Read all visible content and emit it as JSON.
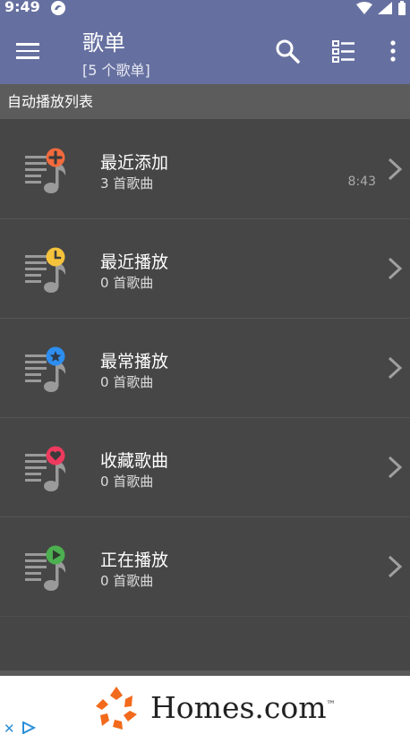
{
  "status_bar": {
    "time": "9:49"
  },
  "app_bar": {
    "title": "歌单",
    "subtitle": "[5 个歌单]",
    "actions": [
      "search-icon",
      "list-view-icon",
      "more-vert-icon"
    ]
  },
  "section": {
    "label": "自动播放列表"
  },
  "playlists": [
    {
      "title": "最近添加",
      "count": "3 首歌曲",
      "duration": "8:43",
      "badge_icon": "plus-icon",
      "badge_color": "#f26a3d"
    },
    {
      "title": "最近播放",
      "count": "0 首歌曲",
      "duration": "",
      "badge_icon": "clock-icon",
      "badge_color": "#f5c23c"
    },
    {
      "title": "最常播放",
      "count": "0 首歌曲",
      "duration": "",
      "badge_icon": "star-icon",
      "badge_color": "#2d8ef0"
    },
    {
      "title": "收藏歌曲",
      "count": "0 首歌曲",
      "duration": "",
      "badge_icon": "heart-icon",
      "badge_color": "#ee3a5e"
    },
    {
      "title": "正在播放",
      "count": "0 首歌曲",
      "duration": "",
      "badge_icon": "play-icon",
      "badge_color": "#4caf50"
    }
  ],
  "ad": {
    "brand": "Homes.com",
    "trademark": "™",
    "close": "✕",
    "logo_color": "#f26a1b"
  },
  "colors": {
    "app_bar": "#6670a0",
    "background": "#464646",
    "section_header": "#5c5c5c"
  }
}
